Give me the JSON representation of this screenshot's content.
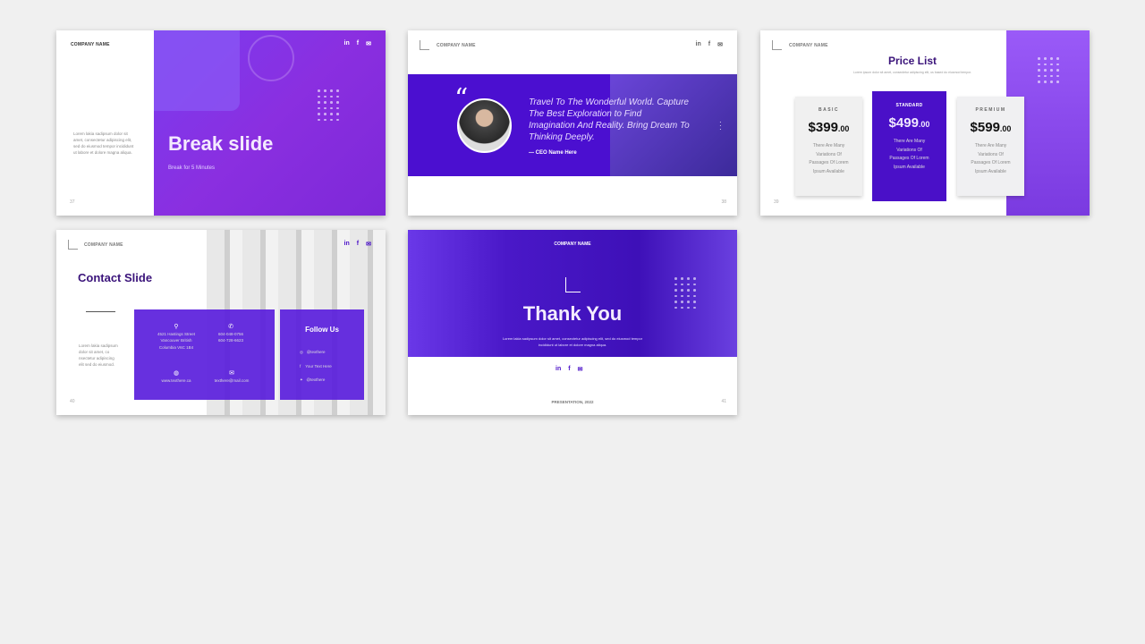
{
  "company_name": "COMPANY NAME",
  "accent": "#6a24e0",
  "dark_accent": "#4a0fc8",
  "social_icons": [
    "linkedin-icon",
    "facebook-icon",
    "email-icon"
  ],
  "social_glyphs": {
    "linkedin": "in",
    "facebook": "f",
    "email": "✉"
  },
  "slides": [
    {
      "title": "Break slide",
      "subtitle": "Break for 5 Minutes",
      "body": "Lorem lakia sadipsum dolor sit amet, consectetur adipiscing elit, sed do eiusmod tempor incididunt ut labore et dolore magna aliqua.",
      "page": "37"
    },
    {
      "quote": "Travel To The Wonderful World. Capture The Best Exploration to Find Imagination And Reality. Bring Dream To Thinking Deeply.",
      "author": "CEO Name Here",
      "page": "38"
    },
    {
      "title": "Price List",
      "subtitle": "Lorem ipsum dolor sit amet, consectetur adipiscing elit, us based do eiusmod tempor.",
      "page": "39",
      "plans": [
        {
          "name": "BASIC",
          "price": "$399",
          "cents": ".00",
          "desc": "There Are Many Variations Of Passages Of Lorem Ipsum Available"
        },
        {
          "name": "STANDARD",
          "price": "$499",
          "cents": ".00",
          "desc": "There Are Many Variations Of Passages Of Lorem Ipsum Available"
        },
        {
          "name": "PREMIUM",
          "price": "$599",
          "cents": ".00",
          "desc": "There Are Many Variations Of Passages Of Lorem Ipsum Available"
        }
      ]
    },
    {
      "title": "Contact Slide",
      "body": "Lorem lakia sadipsum dolor sit amet, co nsectetur adipiscing elit sed do eiusmod.",
      "page": "40",
      "address": "4521 Hastings Street Vancouver British Columbia V6C 1B4",
      "phone1": "604-048-0756",
      "phone2": "604-728-6623",
      "website": "www.texthere.ca",
      "email": "texthere@mail.com",
      "follow_title": "Follow Us",
      "instagram": "@texthere",
      "facebook": "Your Text Here",
      "twitter": "@texthere"
    },
    {
      "title": "Thank You",
      "body": "Lorem lakia sadipsum dolor sit amet, consectetur adipiscing elit, sed do eiusmod tempor incididunt ut labore et dolore magna aliqua.",
      "footer": "PRESENTATION, 2022",
      "page": "41"
    }
  ]
}
